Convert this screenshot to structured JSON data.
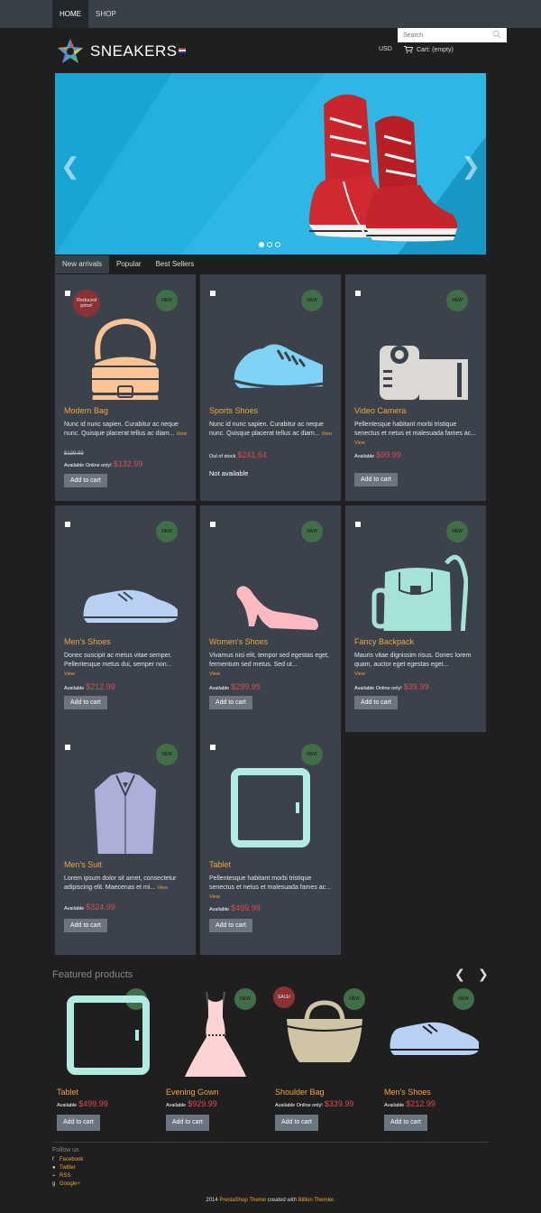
{
  "nav": {
    "items": [
      "HOME",
      "SHOP"
    ]
  },
  "header": {
    "brand": "SNEAKERS",
    "currency": "USD",
    "cart": "Cart: (empty)"
  },
  "search": {
    "placeholder": "Search"
  },
  "tabs": [
    "New arrivals",
    "Popular",
    "Best Sellers"
  ],
  "products": [
    {
      "name": "Modern Bag",
      "desc": "Nunc id nunc sapien. Curabitur ac neque nunc. Quisque placerat tellus ac diam...",
      "view": "View",
      "old_price": "$139.99",
      "availability": "Available Online only!",
      "price": "$132.99",
      "badge": "NEW",
      "reduced": "Reduced price!",
      "button": "Add to cart"
    },
    {
      "name": "Sports Shoes",
      "desc": "Nunc id nunc sapien. Curabitur ac neque nunc. Quisque placerat tellus ac diam...",
      "view": "View",
      "availability": "Out of stock",
      "price": "$241.64",
      "badge": "NEW",
      "not_available": "Not available"
    },
    {
      "name": "Video Camera",
      "desc": "Pellentesque habitant morbi tristique senectus et netus et malesuada fames ac...",
      "view": "View",
      "availability": "Available",
      "price": "$99.99",
      "badge": "NEW",
      "button": "Add to cart"
    },
    {
      "name": "Men's Shoes",
      "desc": "Donec suscipit ac metus vitae semper. Pellentesque metus dui, semper non...",
      "view": "View",
      "availability": "Available",
      "price": "$212.99",
      "badge": "NEW",
      "button": "Add to cart"
    },
    {
      "name": "Women's Shoes",
      "desc": "Vivamus nisi elit, tempor sed egestas eget, fermentum sed metus. Sed ut...",
      "view": "View",
      "availability": "Available",
      "price": "$299.99",
      "badge": "NEW",
      "button": "Add to cart"
    },
    {
      "name": "Fancy Backpack",
      "desc": "Mauris vitae dignissim risus. Donec lorem quam, auctor eget egestas eget...",
      "view": "View",
      "availability": "Available Online only!",
      "price": "$39.99",
      "badge": "NEW",
      "button": "Add to cart"
    },
    {
      "name": "Men's Suit",
      "desc": "Lorem ipsum dolor sit amet, consectetur adipiscing elit. Maecenas et mi...",
      "view": "View",
      "availability": "Available",
      "price": "$324.99",
      "badge": "NEW",
      "button": "Add to cart"
    },
    {
      "name": "Tablet",
      "desc": "Pellentesque habitant morbi tristique senectus et netus et malesuada fames ac...",
      "view": "View",
      "availability": "Available",
      "price": "$499.99",
      "badge": "NEW",
      "button": "Add to cart"
    }
  ],
  "featured": {
    "title": "Featured products",
    "items": [
      {
        "name": "Tablet",
        "availability": "Available",
        "price": "$499.99",
        "badge": "NEW",
        "button": "Add to cart"
      },
      {
        "name": "Evening Gown",
        "availability": "Available",
        "price": "$929.99",
        "badge": "NEW",
        "button": "Add to cart"
      },
      {
        "name": "Shoulder Bag",
        "availability": "Available Online only!",
        "price": "$339.99",
        "badge": "SALE!",
        "badge2": "NEW",
        "button": "Add to cart"
      },
      {
        "name": "Men's Shoes",
        "availability": "Available",
        "price": "$212.99",
        "badge": "NEW",
        "button": "Add to cart"
      }
    ]
  },
  "footer": {
    "follow": "Follow us",
    "social": [
      "Facebook",
      "Twitter",
      "RSS",
      "Google+"
    ],
    "copyright_year": "2014",
    "theme_link": "PrestaShop Theme",
    "created_with": "created with",
    "themler_link": "Billion Themler."
  },
  "colors": {
    "accent": "#f0a53c",
    "price": "#e2494f",
    "card": "#3b424b",
    "new_badge": "#3f6e47",
    "sale_badge": "#8b3232",
    "slider_bg": "#17a5d4"
  }
}
